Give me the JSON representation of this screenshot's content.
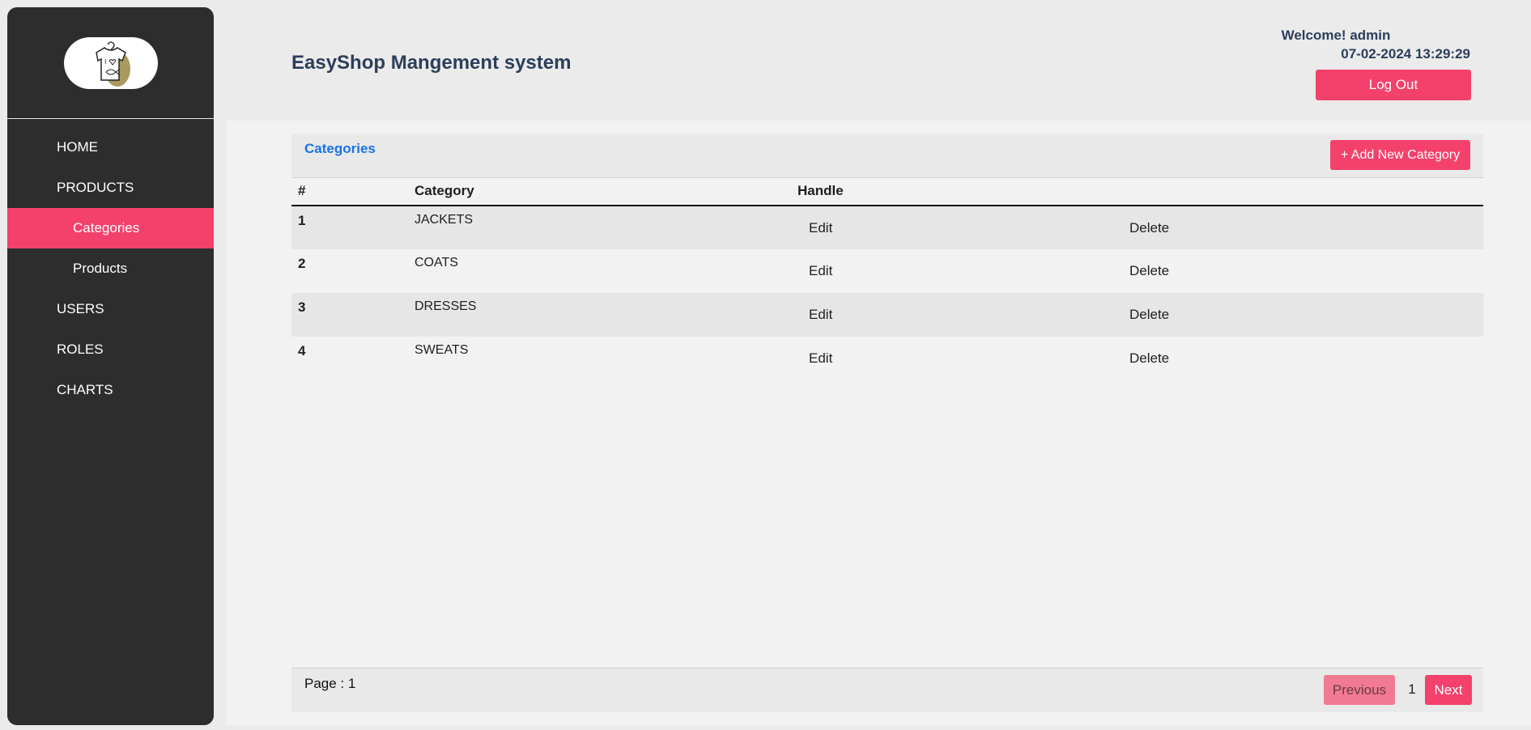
{
  "app": {
    "title": "EasyShop Mangement system",
    "welcome": "Welcome! admin",
    "datetime": "07-02-2024 13:29:29",
    "logout_label": "Log Out"
  },
  "sidebar": {
    "logo_icon": "t-shirt-logo-icon",
    "items": [
      {
        "label": "HOME",
        "sub": false,
        "active": false
      },
      {
        "label": "PRODUCTS",
        "sub": false,
        "active": false
      },
      {
        "label": "Categories",
        "sub": true,
        "active": true
      },
      {
        "label": "Products",
        "sub": true,
        "active": false
      },
      {
        "label": "USERS",
        "sub": false,
        "active": false
      },
      {
        "label": "ROLES",
        "sub": false,
        "active": false
      },
      {
        "label": "CHARTS",
        "sub": false,
        "active": false
      }
    ]
  },
  "panel": {
    "title": "Categories",
    "add_label": "+ Add New Category"
  },
  "table": {
    "headers": [
      "#",
      "Category",
      "Handle"
    ],
    "rows": [
      {
        "num": "1",
        "category": "JACKETS",
        "edit": "Edit",
        "delete": "Delete"
      },
      {
        "num": "2",
        "category": "COATS",
        "edit": "Edit",
        "delete": "Delete"
      },
      {
        "num": "3",
        "category": "DRESSES",
        "edit": "Edit",
        "delete": "Delete"
      },
      {
        "num": "4",
        "category": "SWEATS",
        "edit": "Edit",
        "delete": "Delete"
      }
    ]
  },
  "pagination": {
    "page_label": "Page : 1",
    "previous_label": "Previous",
    "current_page": "1",
    "next_label": "Next"
  },
  "colors": {
    "accent": "#f4416c",
    "sidebar_bg": "#2d2d2d",
    "title_text": "#2c3e5a",
    "link_blue": "#1a73e8"
  }
}
